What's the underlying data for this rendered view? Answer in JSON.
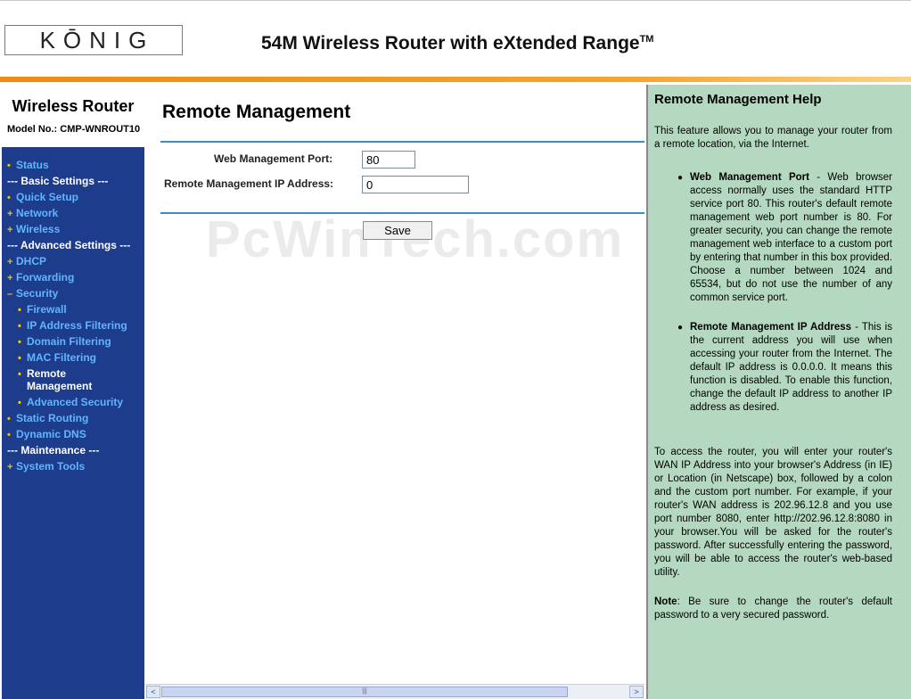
{
  "header": {
    "logo_text": "KŌNIG",
    "product_title": "54M Wireless Router with eXtended Range",
    "trademark": "TM"
  },
  "sidebar": {
    "title": "Wireless Router",
    "model_label": "Model No.:",
    "model_value": "CMP-WNROUT10",
    "items": [
      {
        "label": "Status",
        "bullet": "•"
      },
      {
        "label": "--- Basic Settings ---",
        "bullet": ""
      },
      {
        "label": "Quick Setup",
        "bullet": "•"
      },
      {
        "label": "Network",
        "bullet": "+"
      },
      {
        "label": "Wireless",
        "bullet": "+"
      },
      {
        "label": "--- Advanced Settings ---",
        "bullet": ""
      },
      {
        "label": "DHCP",
        "bullet": "+"
      },
      {
        "label": "Forwarding",
        "bullet": "+"
      },
      {
        "label": "Security",
        "bullet": "–"
      },
      {
        "label": "Firewall",
        "bullet": "•"
      },
      {
        "label": "IP Address Filtering",
        "bullet": "•"
      },
      {
        "label": "Domain Filtering",
        "bullet": "•"
      },
      {
        "label": "MAC Filtering",
        "bullet": "•"
      },
      {
        "label": "Remote",
        "bullet": "•"
      },
      {
        "label": "Management",
        "bullet": ""
      },
      {
        "label": "Advanced Security",
        "bullet": "•"
      },
      {
        "label": "Static Routing",
        "bullet": "•"
      },
      {
        "label": "Dynamic DNS",
        "bullet": "•"
      },
      {
        "label": "--- Maintenance ---",
        "bullet": ""
      },
      {
        "label": "System Tools",
        "bullet": "+"
      }
    ]
  },
  "main": {
    "title": "Remote Management",
    "port_label": "Web Management Port:",
    "port_value": "80",
    "ip_label": "Remote Management IP Address:",
    "ip_value": "0",
    "save_label": "Save",
    "watermark": "PcWinTech.com"
  },
  "help": {
    "title": "Remote Management Help",
    "intro": "This feature allows you to manage your router from a remote location, via the Internet.",
    "port_heading": "Web Management Port",
    "port_text": " - Web browser access normally uses the standard HTTP service port 80. This router's default remote management web port number is 80. For greater security, you can change the remote management web interface to a custom port by entering that number in this box provided. Choose a number between 1024 and 65534, but do not use the number of any common service port.",
    "ip_heading": "Remote Management IP Address",
    "ip_text": " - This is the current address you will use when accessing your router from the Internet. The default IP address is 0.0.0.0. It means this function is disabled. To enable this function, change the default IP address to another IP address as desired.",
    "access_text": "To access the router, you will enter your router's WAN IP Address into your browser's Address (in IE) or Location (in Netscape) box, followed by a colon and the custom port number. For example, if your router's WAN address is 202.96.12.8 and you use port number 8080, enter http://202.96.12.8:8080 in your browser.You will be asked for the router's password. After successfully entering the password, you will be able to access the router's web-based utility.",
    "note_label": "Note",
    "note_text": ": Be sure to change the router's default password to a very secured password."
  },
  "scrollbar": {
    "left_arrow": "<",
    "right_arrow": ">",
    "grip": "|||"
  }
}
